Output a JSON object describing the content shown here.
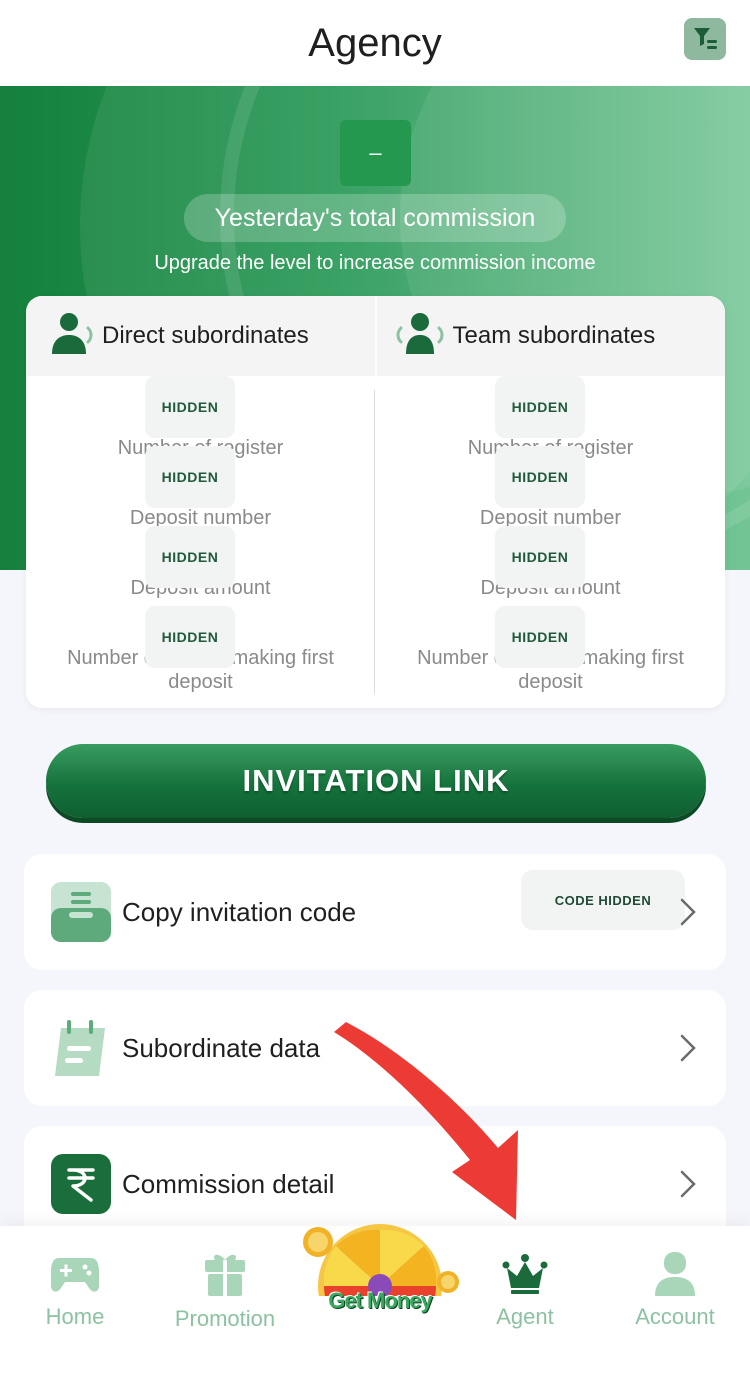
{
  "header": {
    "title": "Agency",
    "filter_icon": "filter-icon"
  },
  "hero": {
    "commission_amount": "–",
    "commission_label": "Yesterday's total commission",
    "upgrade_text": "Upgrade the level to increase commission income"
  },
  "stats": {
    "direct": {
      "title": "Direct subordinates",
      "items": [
        {
          "label": "Number of register",
          "value": "HIDDEN"
        },
        {
          "label": "Deposit number",
          "value": "HIDDEN"
        },
        {
          "label": "Deposit amount",
          "value": "HIDDEN"
        },
        {
          "label": "Number of people making first deposit",
          "value": "HIDDEN"
        }
      ]
    },
    "team": {
      "title": "Team subordinates",
      "items": [
        {
          "label": "Number of register",
          "value": "HIDDEN"
        },
        {
          "label": "Deposit number",
          "value": "HIDDEN"
        },
        {
          "label": "Deposit amount",
          "value": "HIDDEN"
        },
        {
          "label": "Number of people making first deposit",
          "value": "HIDDEN"
        }
      ]
    }
  },
  "invitation_button": "INVITATION LINK",
  "menu": {
    "copy_code": {
      "label": "Copy invitation code",
      "value": "CODE HIDDEN"
    },
    "subordinate_data": {
      "label": "Subordinate data"
    },
    "commission_detail": {
      "label": "Commission detail"
    }
  },
  "tabbar": {
    "home": "Home",
    "promotion": "Promotion",
    "get_money": "Get Money",
    "agent": "Agent",
    "account": "Account"
  },
  "colors": {
    "primary": "#15733c",
    "hero_start": "#15803d",
    "hero_end": "#73c595",
    "tab_inactive": "#8cc2a1",
    "tab_active": "#1b6a3c",
    "annotation_arrow": "#ec3b34"
  }
}
